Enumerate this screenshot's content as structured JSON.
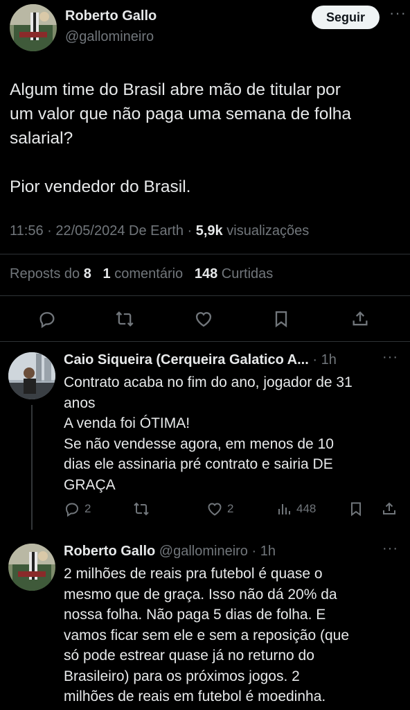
{
  "tweet": {
    "author": {
      "name": "Roberto Gallo",
      "handle": "@gallomineiro"
    },
    "follow_label": "Seguir",
    "more_label": "···",
    "text_lines": [
      "Algum time do Brasil abre mão de titular por",
      "um valor que não paga uma semana de folha",
      "salarial?",
      "Pior vendedor do Brasil."
    ],
    "meta": {
      "time": "11:56",
      "date": "22/05/2024",
      "source": "De Earth",
      "views_count": "5,9k",
      "views_label": "visualizações"
    },
    "stats": {
      "reposts_label": "Reposts do",
      "reposts_count": "8",
      "comments_count": "1",
      "comments_label": "comentário",
      "likes_count": "148",
      "likes_label": "Curtidas"
    },
    "action_icons": [
      "reply-icon",
      "repost-icon",
      "like-icon",
      "bookmark-icon",
      "share-icon"
    ]
  },
  "replies": [
    {
      "name": "Caio Siqueira (Cerqueira Galatico A...",
      "handle": "",
      "time": "· 1h",
      "more_label": "···",
      "lines": [
        "Contrato acaba no fim do ano, jogador de 31",
        "anos",
        "A venda foi ÓTIMA!",
        "Se não vendesse agora, em menos de 10",
        "dias ele assinaria pré contrato e sairia DE",
        "GRAÇA"
      ],
      "actions": {
        "replies": "2",
        "reposts": "",
        "likes": "2",
        "views": "448"
      }
    },
    {
      "name": "Roberto Gallo",
      "handle": "@gallomineiro",
      "time": "· 1h",
      "more_label": "···",
      "lines": [
        "2 milhões de reais pra futebol é quase o",
        "mesmo que de graça. Isso não dá 20% da",
        "nossa folha. Não paga 5 dias de folha. E",
        "vamos ficar sem ele e sem a reposição (que",
        "só pode estrear quase já no returno do",
        "Brasileiro) para os próximos jogos. 2",
        "milhões de reais em futebol é moedinha."
      ]
    }
  ],
  "colors": {
    "background": "#000000",
    "text_primary": "#e7e9ea",
    "text_secondary": "#71767b",
    "divider": "#2f3336",
    "follow_button_bg": "#eff3f4"
  }
}
